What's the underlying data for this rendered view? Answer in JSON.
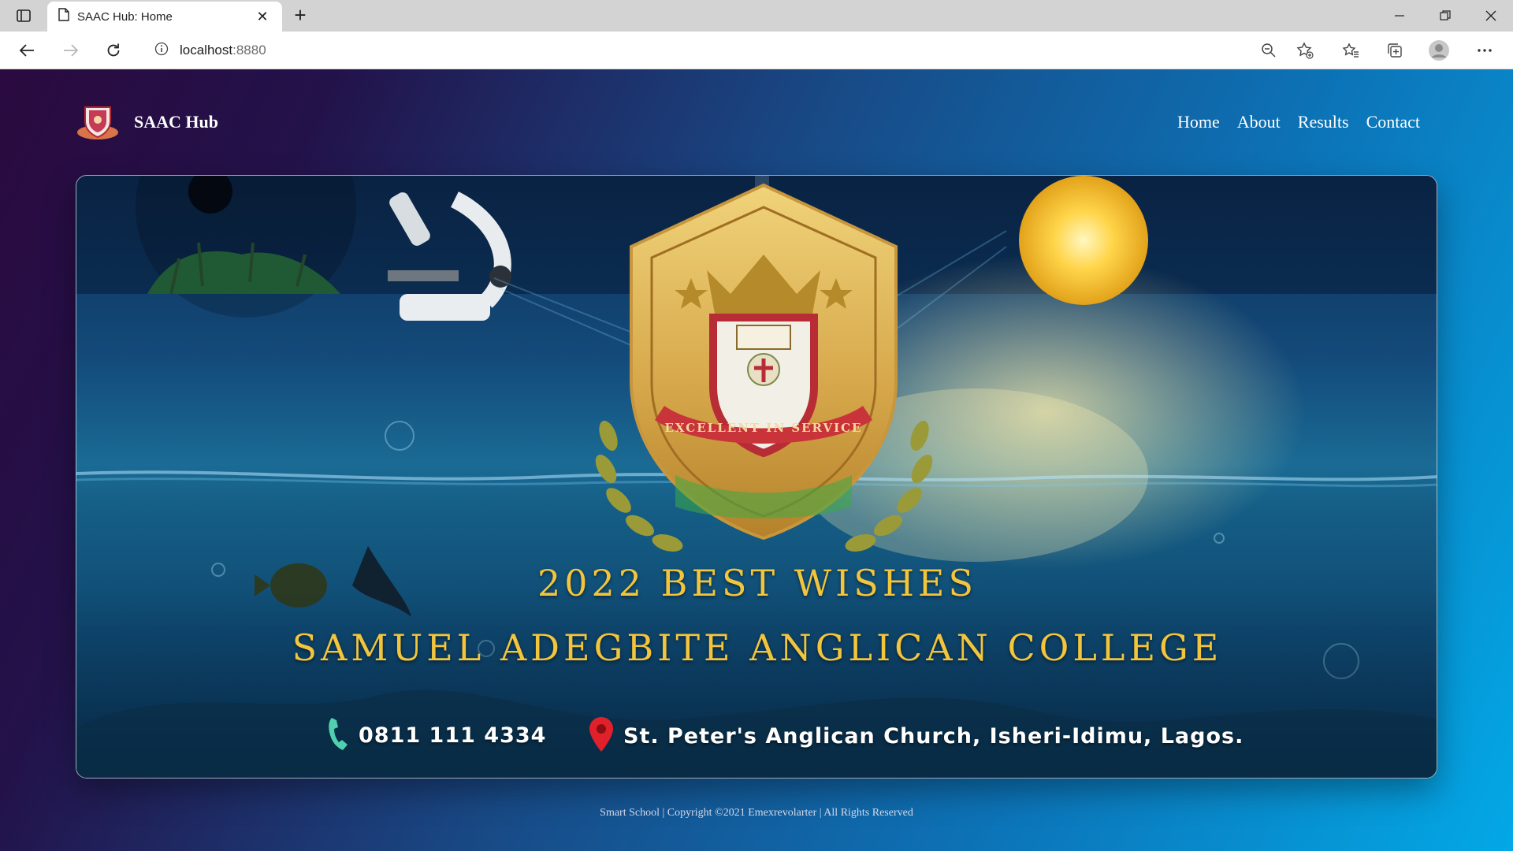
{
  "browser": {
    "tab_title": "SAAC Hub: Home",
    "url_host": "localhost",
    "url_port": ":8880"
  },
  "site": {
    "brand": "SAAC Hub",
    "nav": [
      {
        "label": "Home"
      },
      {
        "label": "About"
      },
      {
        "label": "Results"
      },
      {
        "label": "Contact"
      }
    ]
  },
  "banner": {
    "motto": "EXCELLENT IN SERVICE",
    "greeting": "2022 BEST WISHES",
    "school_name": "SAMUEL ADEGBITE ANGLICAN COLLEGE",
    "phone": "0811 111 4334",
    "address": "St. Peter's Anglican Church, Isheri-Idimu, Lagos."
  },
  "footer": {
    "text": "Smart School | Copyright ©2021 Emexrevolarter | All Rights Reserved"
  },
  "colors": {
    "accent_gold": "#f2c53d",
    "pin_red": "#e0202a",
    "phone_teal": "#4fd1b0"
  }
}
